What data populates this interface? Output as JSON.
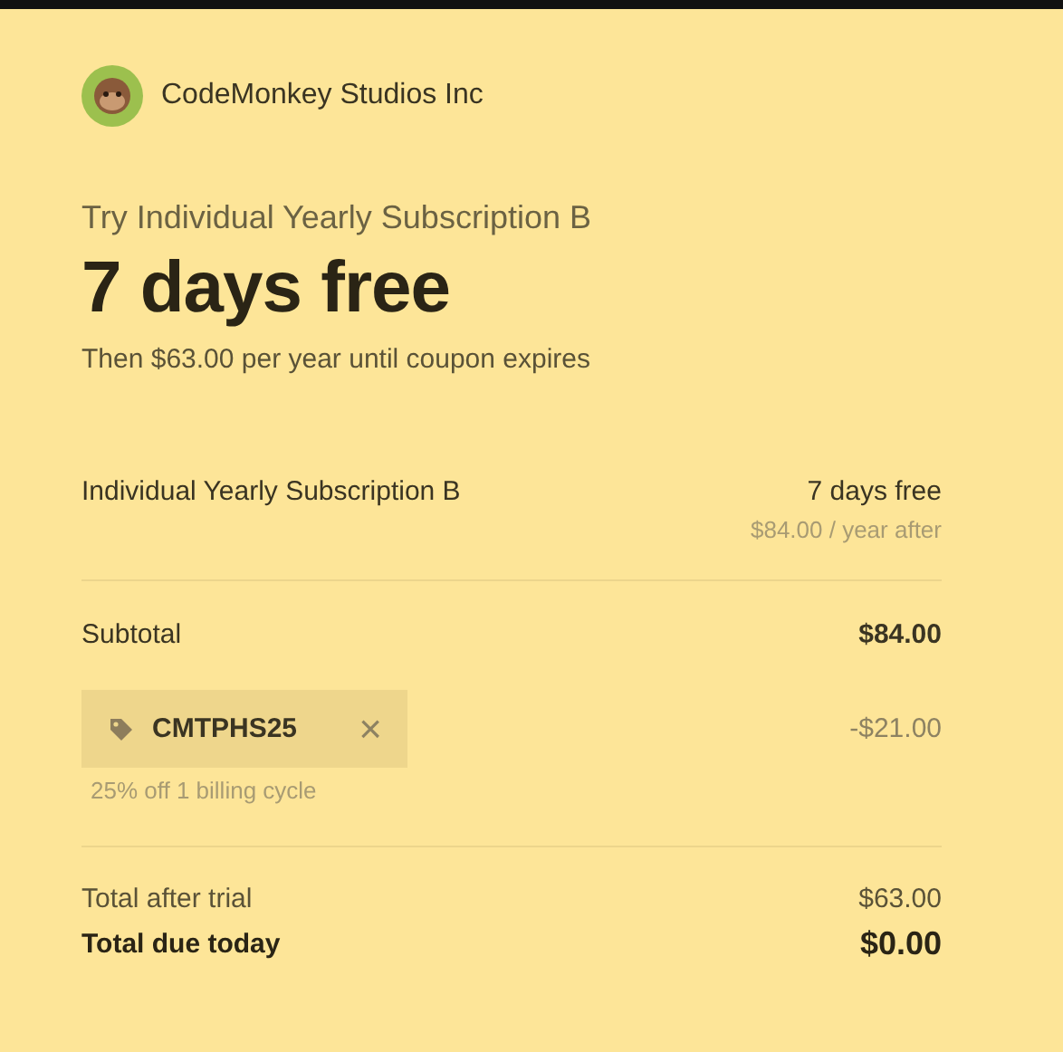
{
  "merchant": {
    "name": "CodeMonkey Studios Inc"
  },
  "offer": {
    "title": "Try Individual Yearly Subscription B",
    "headline": "7 days free",
    "note": "Then $63.00 per year until coupon expires"
  },
  "line_item": {
    "name": "Individual Yearly Subscription B",
    "price": "7 days free",
    "after": "$84.00 / year after"
  },
  "subtotal": {
    "label": "Subtotal",
    "amount": "$84.00"
  },
  "coupon": {
    "code": "CMTPHS25",
    "remove": "×",
    "amount": "-$21.00",
    "description": "25% off 1 billing cycle"
  },
  "totals": [
    {
      "label": "Total after trial",
      "amount": "$63.00",
      "kind": "regular"
    },
    {
      "label": "Total due today",
      "amount": "$0.00",
      "kind": "emphasis"
    }
  ]
}
